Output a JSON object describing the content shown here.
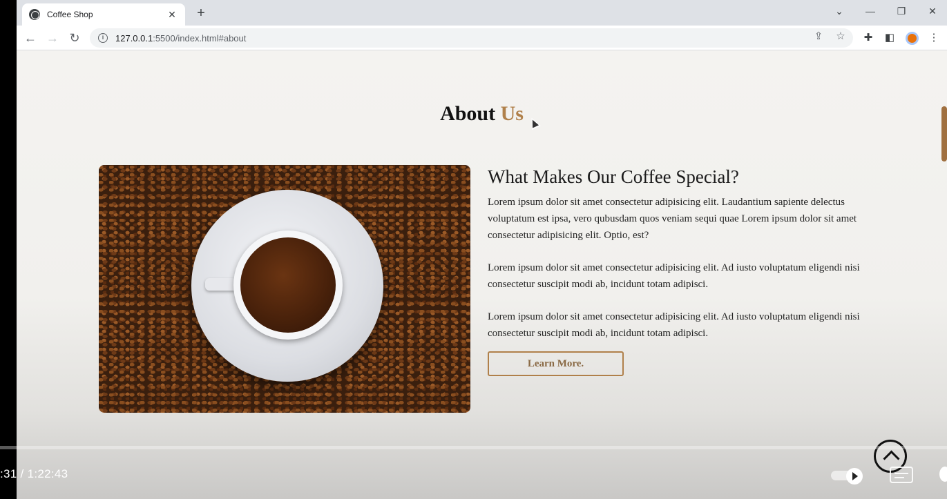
{
  "browser": {
    "tab_title": "Coffee Shop",
    "tab_close": "✕",
    "new_tab": "+",
    "window_controls": {
      "dropdown": "⌄",
      "minimize": "—",
      "restore": "❐",
      "close": "✕"
    },
    "nav": {
      "back": "←",
      "forward": "→",
      "reload": "↻"
    },
    "url_host": "127.0.0.1",
    "url_rest": ":5500/index.html#about",
    "icons": [
      "share-icon",
      "star-icon",
      "extensions-icon",
      "side-panel-icon",
      "profile-avatar",
      "menu-icon"
    ]
  },
  "page": {
    "title_main": "About ",
    "title_accent": "Us",
    "heading": "What Makes Our Coffee Special?",
    "paragraphs": [
      "Lorem ipsum dolor sit amet consectetur adipisicing elit. Laudantium sapiente delectus voluptatum est ipsa, vero qubusdam quos veniam sequi quae Lorem ipsum dolor sit amet consectetur adipisicing elit. Optio, est?",
      "Lorem ipsum dolor sit amet consectetur adipisicing elit. Ad iusto voluptatum eligendi nisi consectetur suscipit modi ab, incidunt totam adipisci.",
      "Lorem ipsum dolor sit amet consectetur adipisicing elit. Ad iusto voluptatum eligendi nisi consectetur suscipit modi ab, incidunt totam adipisci."
    ],
    "button_label": "Learn More."
  },
  "player": {
    "time": ":31 / 1:22:43"
  },
  "colors": {
    "accent": "#b0804a",
    "page_bg": "#f4f3f0"
  }
}
